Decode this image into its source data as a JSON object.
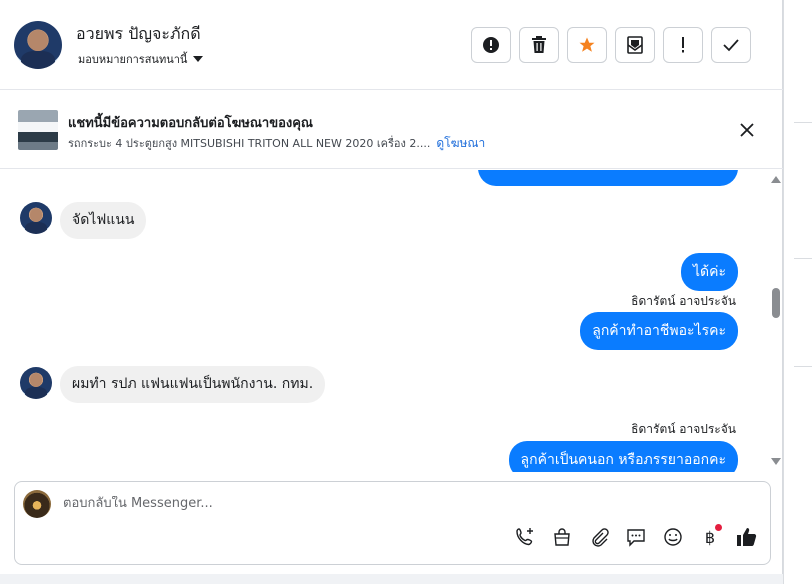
{
  "header": {
    "contact_name": "อวยพร ปัญจะภักดี",
    "assign_label": "มอบหมายการสนทนานี้"
  },
  "ad_banner": {
    "title": "แชทนี้มีข้อความตอบกลับต่อโฆษณาของคุณ",
    "subtitle": "รถกระบะ 4 ประตูยกสูง MITSUBISHI TRITON ALL NEW 2020 เครื่อง 2....",
    "link_label": "ดูโฆษณา"
  },
  "messages": [
    {
      "id": "m1",
      "direction": "in",
      "text": "จัดไฟแนน"
    },
    {
      "id": "m2",
      "direction": "out",
      "text": "ได้ค่ะ"
    },
    {
      "id": "m3",
      "direction": "out",
      "sender": "ธิดารัตน์ อาจประจัน",
      "text": "ลูกค้าทำอาชีพอะไรคะ"
    },
    {
      "id": "m4",
      "direction": "in",
      "text": "ผมทำ รปภ แฟนแฟนเป็นพนักงาน.   กทม."
    },
    {
      "id": "m5",
      "direction": "out",
      "sender": "ธิดารัตน์ อาจประจัน",
      "text": "ลูกค้าเป็นคนอก หรือภรรยาออกคะ"
    }
  ],
  "composer": {
    "placeholder": "ตอบกลับใน Messenger..."
  },
  "colors": {
    "outgoing_bubble": "#0a7cff",
    "incoming_bubble": "#f0f0f0",
    "star_accent": "#f5821f",
    "link": "#216fdb",
    "notification_dot": "#e41e3f"
  },
  "icons": {
    "header_actions": [
      "alert-circle-icon",
      "trash-icon",
      "star-icon",
      "mark-unread-icon",
      "exclamation-icon",
      "check-icon"
    ],
    "composer_tools": [
      "call-add-icon",
      "shopping-bag-icon",
      "paperclip-icon",
      "saved-reply-icon",
      "emoji-icon",
      "baht-icon",
      "thumbs-up-icon"
    ]
  }
}
